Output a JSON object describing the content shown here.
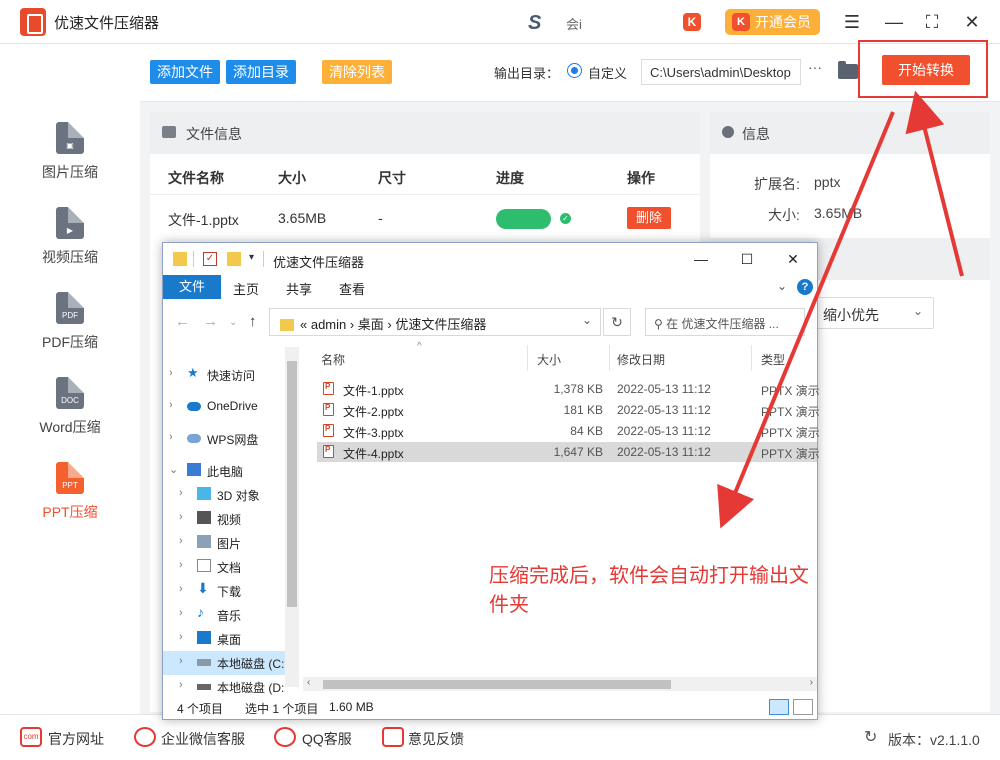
{
  "app": {
    "title": "优速文件压缩器",
    "center_text": "会i",
    "vip_label": "开通会员",
    "vip_icon": "K",
    "k_icon": "K"
  },
  "window_controls": {
    "menu": "☰",
    "minimize": "—",
    "maximize": "⛶",
    "close": "✕"
  },
  "sidebar": {
    "items": [
      {
        "label": "图片压缩",
        "icon": "image-doc-icon",
        "active": false
      },
      {
        "label": "视频压缩",
        "icon": "video-doc-icon",
        "active": false
      },
      {
        "label": "PDF压缩",
        "icon_text": "PDF",
        "active": false
      },
      {
        "label": "Word压缩",
        "icon_text": "DOC",
        "active": false
      },
      {
        "label": "PPT压缩",
        "icon_text": "PPT",
        "active": true
      }
    ]
  },
  "toolbar": {
    "add_file": "添加文件",
    "add_dir": "添加目录",
    "clear_list": "清除列表",
    "output_label": "输出目录：",
    "custom_label": "自定义",
    "path_value": "C:\\Users\\admin\\Desktop",
    "more": "···",
    "start": "开始转换"
  },
  "file_panel": {
    "title": "文件信息",
    "columns": [
      "文件名称",
      "大小",
      "尺寸",
      "进度",
      "操作"
    ],
    "rows": [
      {
        "name": "文件-1.pptx",
        "size": "3.65MB",
        "dimension": "-",
        "progress": 1.0,
        "action": "删除"
      }
    ]
  },
  "info_panel": {
    "title": "信息",
    "ext_label": "扩展名:",
    "ext_value": "pptx",
    "size_label": "大小:",
    "size_value": "3.65MB",
    "priority_value": "缩小优先"
  },
  "bottom": {
    "website": "官方网址",
    "wecom": "企业微信客服",
    "qq": "QQ客服",
    "feedback": "意见反馈",
    "version": "版本：v2.1.1.0"
  },
  "explorer": {
    "title": "优速文件压缩器",
    "ribbon_tabs": [
      "文件",
      "主页",
      "共享",
      "查看"
    ],
    "address": [
      "«",
      "admin",
      "›",
      "桌面",
      "›",
      "优速文件压缩器"
    ],
    "address_text": "«  admin  ›  桌面  ›  优速文件压缩器",
    "search_placeholder": "在 优速文件压缩器 ...",
    "nav_items": [
      {
        "label": "快速访问",
        "level": 0
      },
      {
        "label": "OneDrive",
        "level": 0
      },
      {
        "label": "WPS网盘",
        "level": 0
      },
      {
        "label": "此电脑",
        "level": 0
      },
      {
        "label": "3D 对象",
        "level": 1
      },
      {
        "label": "视频",
        "level": 1
      },
      {
        "label": "图片",
        "level": 1
      },
      {
        "label": "文档",
        "level": 1
      },
      {
        "label": "下载",
        "level": 1
      },
      {
        "label": "音乐",
        "level": 1
      },
      {
        "label": "桌面",
        "level": 1
      },
      {
        "label": "本地磁盘 (C:",
        "level": 1,
        "selected": true
      },
      {
        "label": "本地磁盘 (D:",
        "level": 1
      }
    ],
    "columns": [
      "名称",
      "大小",
      "修改日期",
      "类型"
    ],
    "files": [
      {
        "name": "文件-1.pptx",
        "size": "1,378 KB",
        "date": "2022-05-13 11:12",
        "type": "PPTX 演示"
      },
      {
        "name": "文件-2.pptx",
        "size": "181 KB",
        "date": "2022-05-13 11:12",
        "type": "PPTX 演示"
      },
      {
        "name": "文件-3.pptx",
        "size": "84 KB",
        "date": "2022-05-13 11:12",
        "type": "PPTX 演示"
      },
      {
        "name": "文件-4.pptx",
        "size": "1,647 KB",
        "date": "2022-05-13 11:12",
        "type": "PPTX 演示",
        "selected": true
      }
    ],
    "annotation": "压缩完成后，软件会自动打开输出文件夹",
    "status_count": "4 个项目",
    "status_selected": "选中 1 个项目",
    "status_size": "1.60 MB"
  },
  "colors": {
    "accent": "#f0502d",
    "blue": "#1e7ce8",
    "annotation": "#e53935"
  }
}
